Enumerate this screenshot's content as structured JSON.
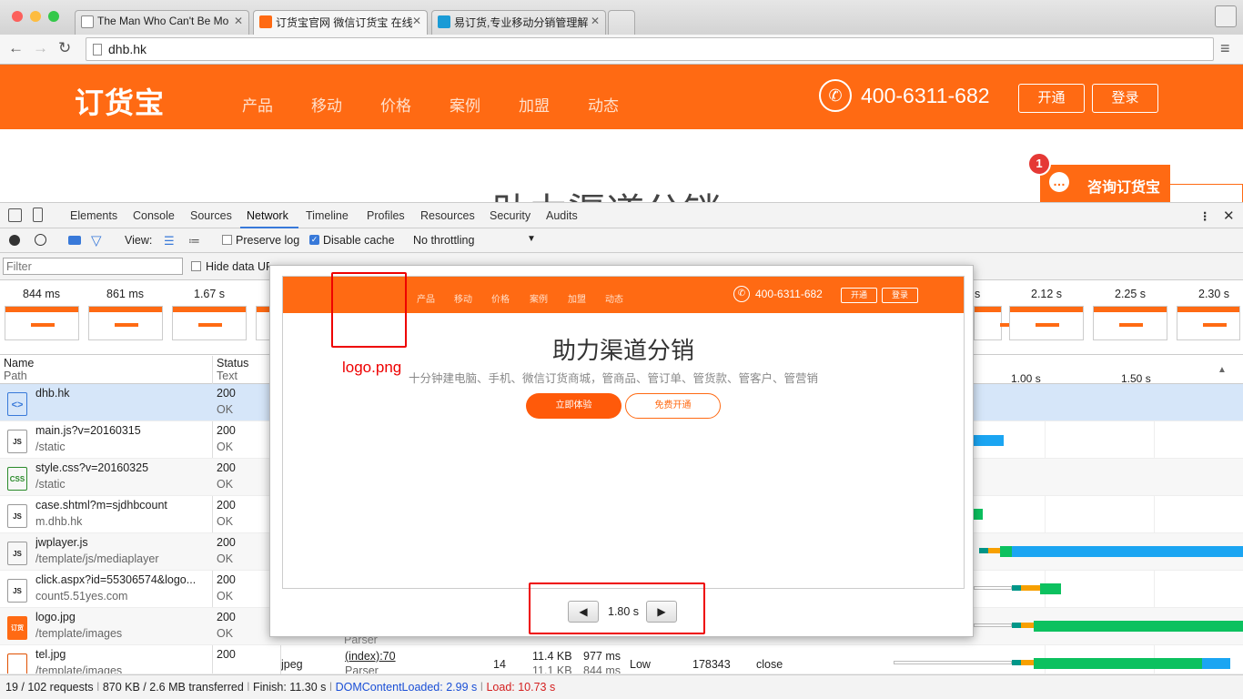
{
  "browser": {
    "tabs": [
      {
        "title": "The Man Who Can't Be Mo",
        "active": false
      },
      {
        "title": "订货宝官网 微信订货宝 在线",
        "active": true
      },
      {
        "title": "易订货,专业移动分销管理解",
        "active": false
      }
    ],
    "url": "dhb.hk"
  },
  "site": {
    "logo_text": "订货宝",
    "nav": [
      "产品",
      "移动",
      "价格",
      "案例",
      "加盟",
      "动态"
    ],
    "phone": "400-6311-682",
    "open_label": "开通",
    "login_label": "登录",
    "hero_title": "助力渠道分销",
    "chat_label": "咨询订货宝",
    "chat_badge": "1"
  },
  "devtools": {
    "tabs": [
      "Elements",
      "Console",
      "Sources",
      "Network",
      "Timeline",
      "Profiles",
      "Resources",
      "Security",
      "Audits"
    ],
    "active_tab": "Network",
    "toolbar": {
      "view_label": "View:",
      "preserve_log": "Preserve log",
      "disable_cache": "Disable cache",
      "throttling": "No throttling"
    },
    "filter": {
      "placeholder": "Filter",
      "hide_data_urls": "Hide data URLs"
    },
    "filmstrip_times_left": [
      "844 ms",
      "861 ms",
      "1.67 s"
    ],
    "filmstrip_times_right": [
      "s",
      "2.12 s",
      "2.25 s",
      "2.30 s"
    ],
    "columns": {
      "name": "Name",
      "path": "Path",
      "status": "Status",
      "text": "Text"
    },
    "timeline_ticks": [
      "1.00 s",
      "1.50 s"
    ],
    "rows": [
      {
        "name": "dhb.hk",
        "path": "",
        "status": "200",
        "text": "OK",
        "type": "html"
      },
      {
        "name": "main.js?v=20160315",
        "path": "/static",
        "status": "200",
        "text": "OK",
        "type": "js"
      },
      {
        "name": "style.css?v=20160325",
        "path": "/static",
        "status": "200",
        "text": "OK",
        "type": "css"
      },
      {
        "name": "case.shtml?m=sjdhbcount",
        "path": "m.dhb.hk",
        "status": "200",
        "text": "OK",
        "type": "js"
      },
      {
        "name": "jwplayer.js",
        "path": "/template/js/mediaplayer",
        "status": "200",
        "text": "OK",
        "type": "js"
      },
      {
        "name": "click.aspx?id=55306574&logo...",
        "path": "count5.51yes.com",
        "status": "200",
        "text": "OK",
        "type": "js"
      },
      {
        "name": "logo.jpg",
        "path": "/template/images",
        "status": "200",
        "text": "OK",
        "type": "img",
        "initiator_sub": "Parser"
      },
      {
        "name": "tel.jpg",
        "path": "/template/images",
        "status": "200",
        "text": "OK",
        "type": "jpeg",
        "initiator": "(index):70",
        "initiator_sub": "Parser",
        "size": "11.4 KB",
        "size_sub": "11.1 KB",
        "time": "977 ms",
        "time_sub": "844 ms",
        "priority": "Low",
        "conn": "178343",
        "conn_type": "close",
        "count": "14"
      }
    ],
    "status": {
      "requests": "19 / 102 requests",
      "transferred": "870 KB / 2.6 MB transferred",
      "finish": "Finish: 11.30 s",
      "dcl": "DOMContentLoaded: 2.99 s",
      "load": "Load: 10.73 s"
    }
  },
  "preview": {
    "nav": [
      "产品",
      "移动",
      "价格",
      "案例",
      "加盟",
      "动态"
    ],
    "phone": "400-6311-682",
    "open_label": "开通",
    "login_label": "登录",
    "title": "助力渠道分销",
    "subtitle": "十分钟建电脑、手机、微信订货商城，管商品、管订单、管货款、管客户、管营销",
    "btn_primary": "立即体验",
    "btn_secondary": "免费开通",
    "annotation": "logo.png",
    "time": "1.80 s",
    "prev_icon": "◀",
    "next_icon": "▶"
  },
  "colors": {
    "brand": "#ff6a13",
    "annotation": "#e00000",
    "dcl": "#1a4fd6",
    "load": "#d42020"
  }
}
